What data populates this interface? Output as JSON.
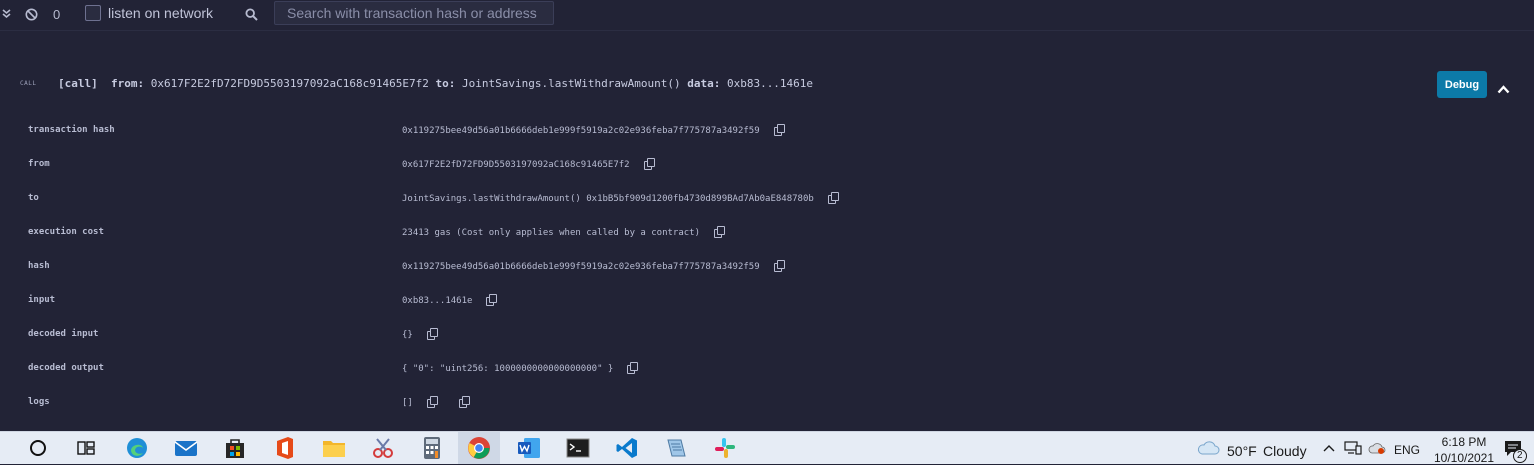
{
  "toolbar": {
    "count": "0",
    "listen_label": "listen on network",
    "search_placeholder": "Search with transaction hash or address"
  },
  "call": {
    "tag": "CALL",
    "kind": "[call]",
    "from_label": "from:",
    "from_value": "0x617F2E2fD72FD9D5503197092aC168c91465E7f2",
    "to_label": "to:",
    "to_value": "JointSavings.lastWithdrawAmount()",
    "data_label": "data:",
    "data_value": "0xb83...1461e",
    "debug_label": "Debug"
  },
  "details": [
    {
      "key": "transaction hash",
      "value": "0x119275bee49d56a01b6666deb1e999f5919a2c02e936feba7f775787a3492f59"
    },
    {
      "key": "from",
      "value": "0x617F2E2fD72FD9D5503197092aC168c91465E7f2"
    },
    {
      "key": "to",
      "value": "JointSavings.lastWithdrawAmount() 0x1bB5bf909d1200fb4730d899BAd7Ab0aE848780b"
    },
    {
      "key": "execution cost",
      "value": "23413 gas (Cost only applies when called by a contract)"
    },
    {
      "key": "hash",
      "value": "0x119275bee49d56a01b6666deb1e999f5919a2c02e936feba7f775787a3492f59"
    },
    {
      "key": "input",
      "value": "0xb83...1461e"
    },
    {
      "key": "decoded input",
      "value": "{}"
    },
    {
      "key": "decoded output",
      "value": "{ \"0\": \"uint256: 1000000000000000000\" }"
    },
    {
      "key": "logs",
      "value": "[]"
    }
  ],
  "taskbar": {
    "weather_temp": "50°F",
    "weather_desc": "Cloudy",
    "language": "ENG",
    "time": "6:18 PM",
    "date": "10/10/2021",
    "notifications": "2"
  },
  "colors": {
    "background": "#222336",
    "debug_button": "#0c7aa8",
    "text": "#c7cbe0",
    "taskbar": "#e6ecf5"
  }
}
